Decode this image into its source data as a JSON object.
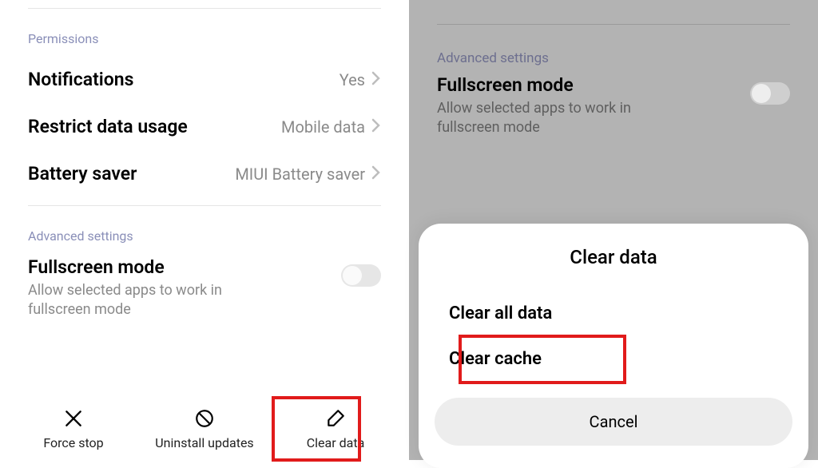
{
  "left": {
    "permissions_header": "Permissions",
    "notifications": {
      "title": "Notifications",
      "value": "Yes"
    },
    "restrict": {
      "title": "Restrict data usage",
      "value": "Mobile data"
    },
    "battery": {
      "title": "Battery saver",
      "value": "MIUI Battery saver"
    },
    "advanced_header": "Advanced settings",
    "fullscreen": {
      "title": "Fullscreen mode",
      "desc": "Allow selected apps to work in fullscreen mode"
    },
    "actions": {
      "force_stop": "Force stop",
      "uninstall_updates": "Uninstall updates",
      "clear_data": "Clear data"
    }
  },
  "right": {
    "advanced_header": "Advanced settings",
    "fullscreen": {
      "title": "Fullscreen mode",
      "desc": "Allow selected apps to work in fullscreen mode"
    },
    "sheet": {
      "title": "Clear data",
      "option_all": "Clear all data",
      "option_cache": "Clear cache",
      "cancel": "Cancel"
    }
  }
}
